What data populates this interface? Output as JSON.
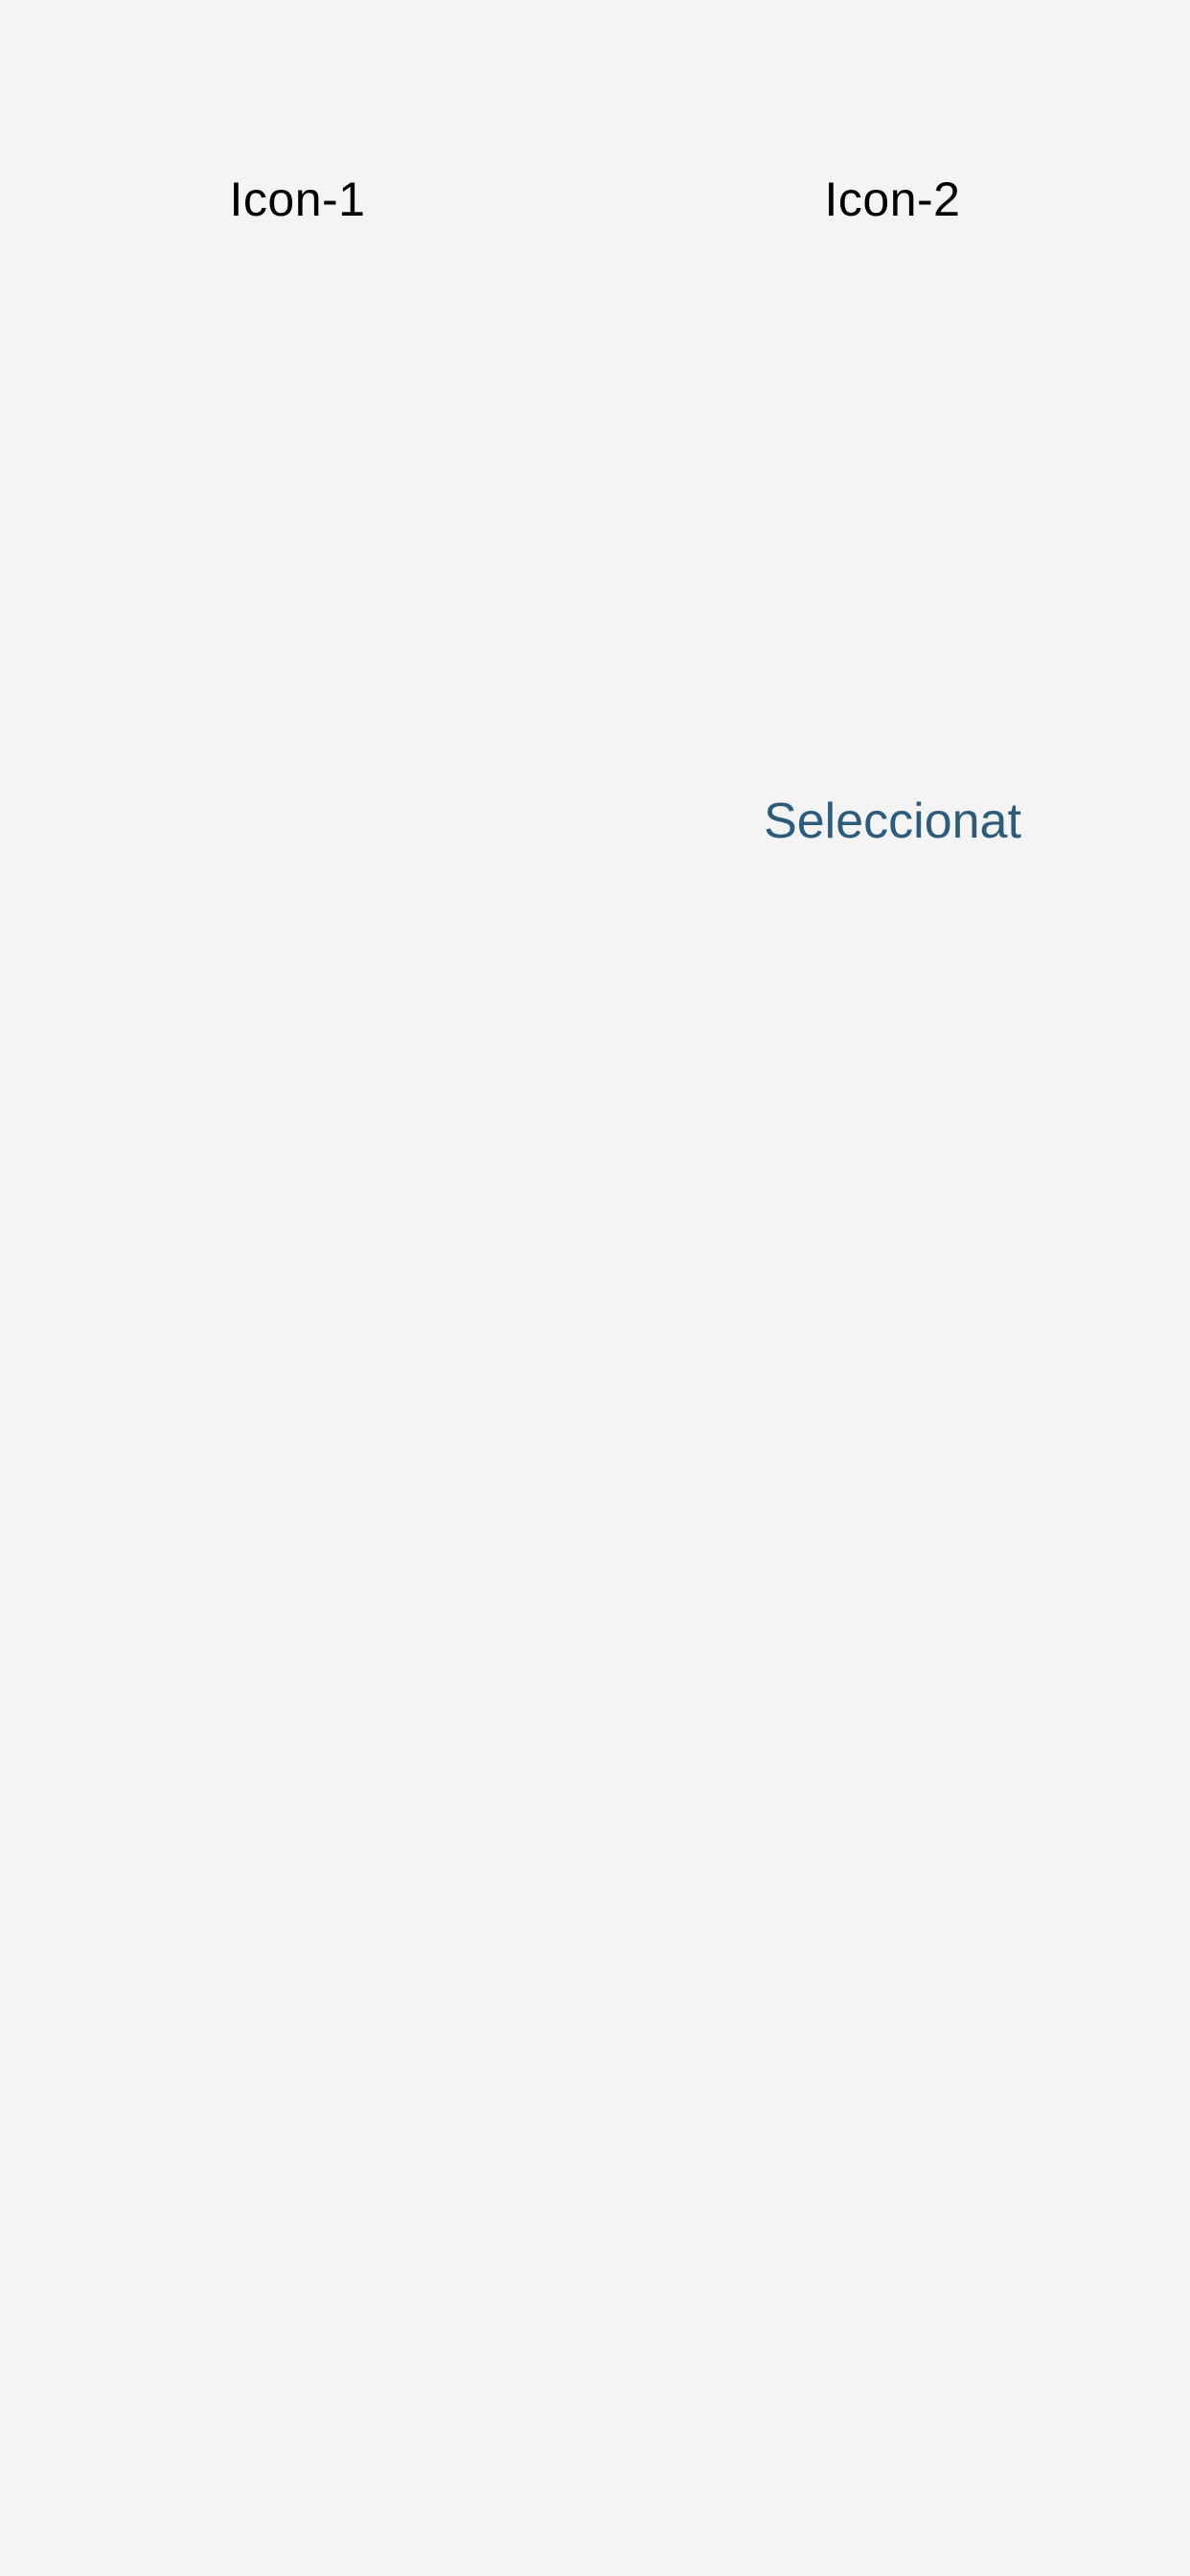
{
  "colors": {
    "background": "#f4f4f4",
    "label_text": "#000000",
    "selected_text": "#2d5b7c"
  },
  "icons": [
    {
      "label": "Icon-1",
      "status": ""
    },
    {
      "label": "Icon-2",
      "status": "Seleccionat"
    }
  ]
}
